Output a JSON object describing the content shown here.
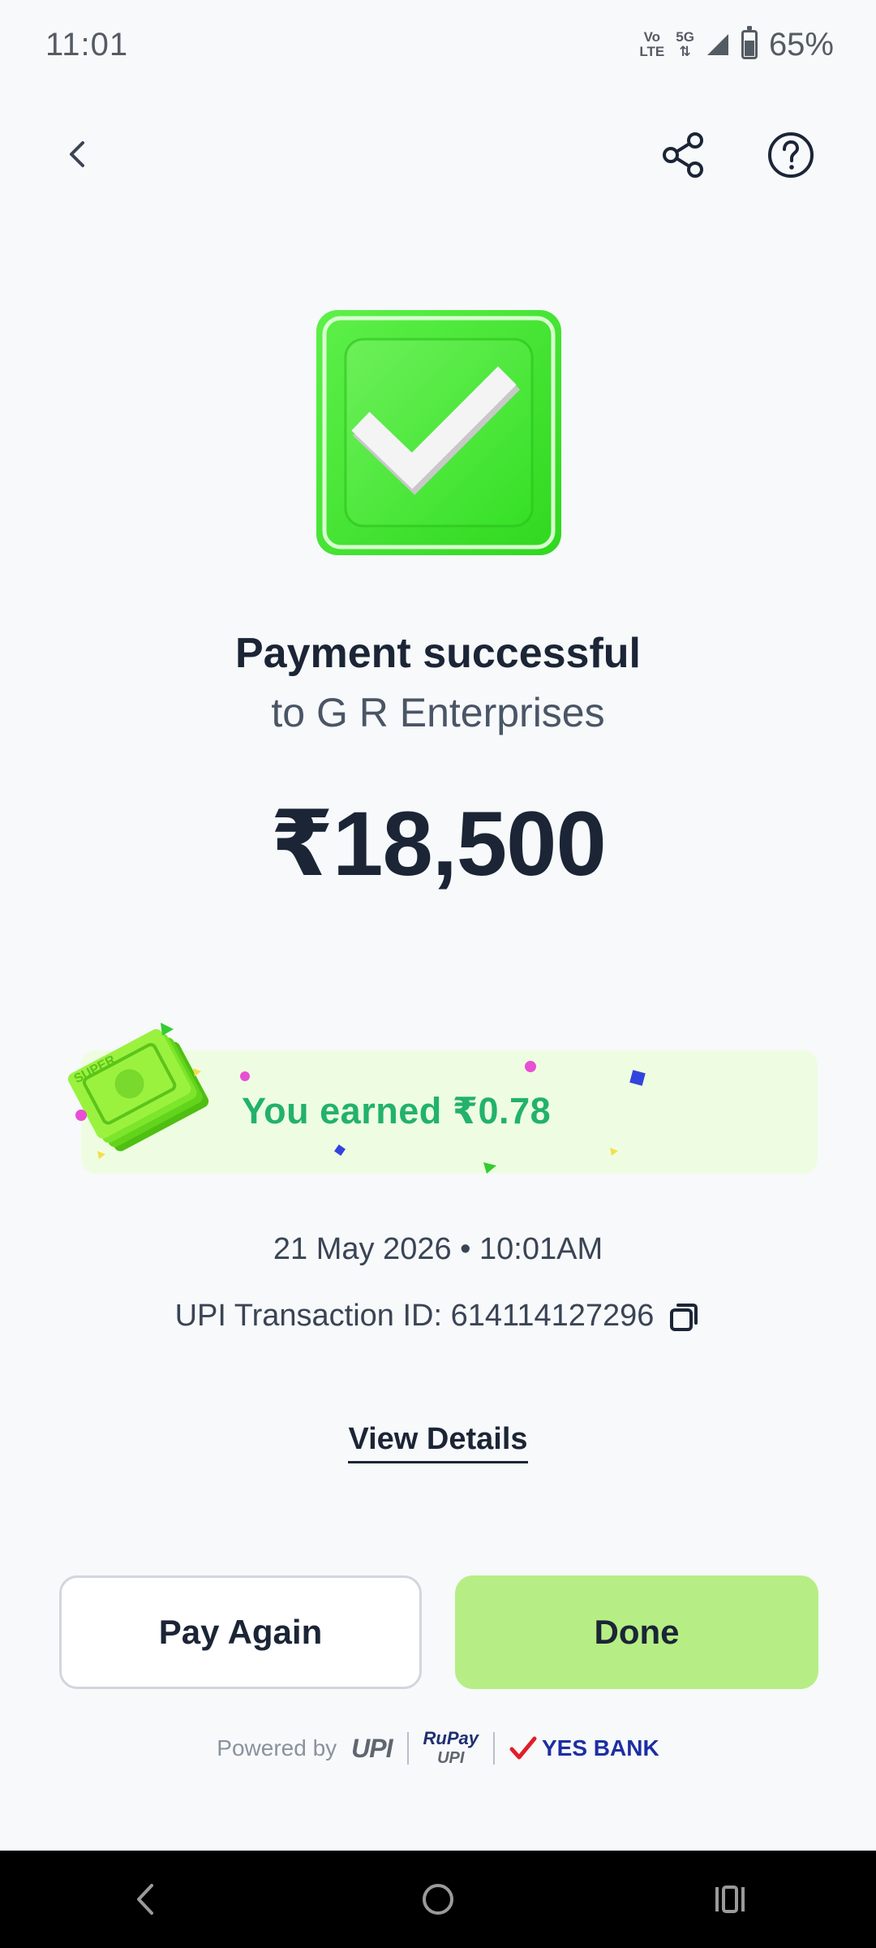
{
  "status_bar": {
    "time": "11:01",
    "network_top": "Vo",
    "network_bottom": "LTE",
    "network_5g": "5G",
    "battery": "65%"
  },
  "header": {
    "back_icon": "chevron-left-icon",
    "share_icon": "share-icon",
    "help_icon": "help-circle-icon"
  },
  "payment": {
    "title": "Payment successful",
    "payee": "to G R Enterprises",
    "amount": "₹18,500"
  },
  "reward": {
    "text": "You earned ₹0.78",
    "art_label": "SUPER"
  },
  "transaction": {
    "date": "21 May 2026 • 10:01AM",
    "upi_id": "UPI Transaction ID: 614114127296"
  },
  "actions": {
    "view_details": "View Details",
    "pay_again": "Pay Again",
    "done": "Done"
  },
  "footer": {
    "powered_by": "Powered by",
    "upi_logo": "UPI",
    "rupay_logo": "RuPay",
    "rupay_sub": "UPI",
    "bank_name": "YES BANK"
  },
  "colors": {
    "accent_green": "#22b269",
    "done_button": "#b6ee85",
    "reward_bg": "#eefde2"
  }
}
